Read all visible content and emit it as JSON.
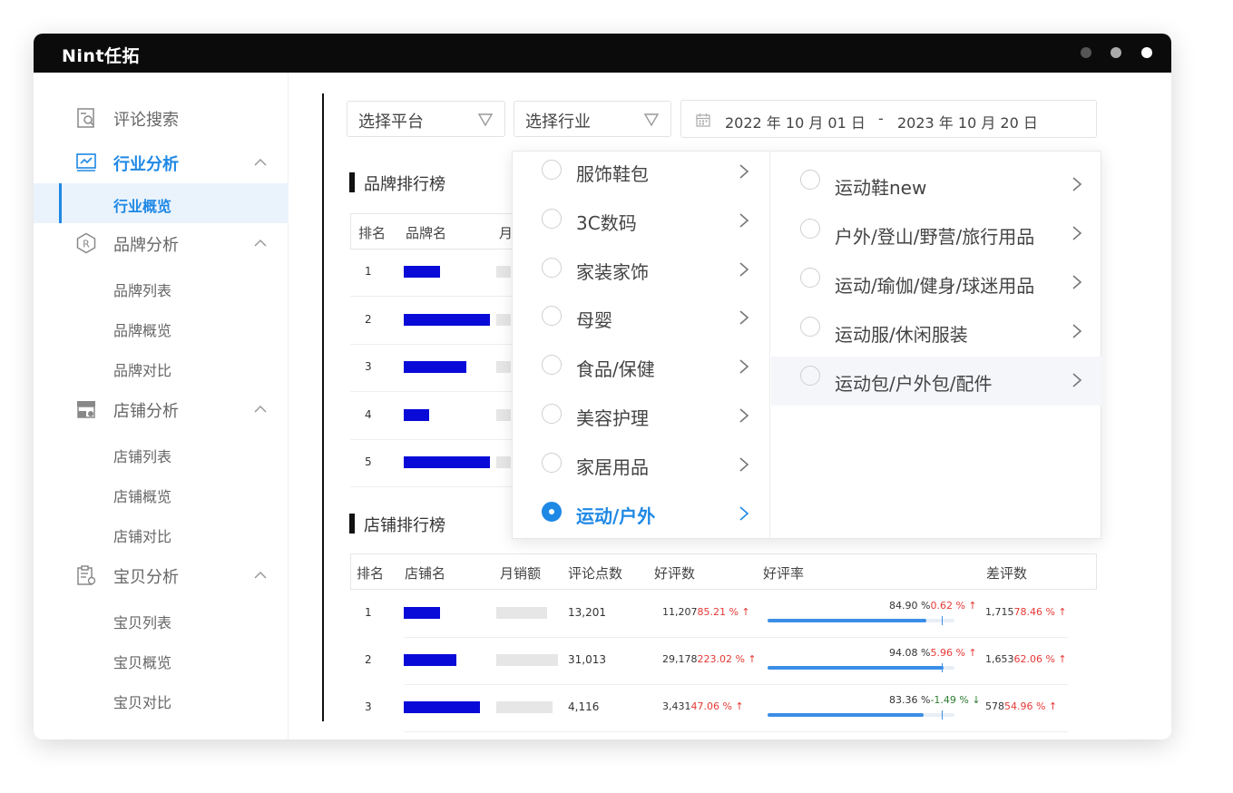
{
  "app": {
    "logo": "Nint任拓"
  },
  "window_dots": [
    "#555555",
    "#aaaaaa",
    "#ffffff"
  ],
  "accent_color": "#1e88e5",
  "sidebar": {
    "groups": [
      {
        "label": "评论搜索",
        "icon": "search-doc-icon",
        "active": false,
        "has_chevron": false,
        "items": []
      },
      {
        "label": "行业分析",
        "icon": "trend-chart-icon",
        "active": true,
        "has_chevron": true,
        "items": [
          {
            "label": "行业概览",
            "active": true
          }
        ]
      },
      {
        "label": "品牌分析",
        "icon": "brand-badge-icon",
        "active": false,
        "has_chevron": true,
        "items": [
          {
            "label": "品牌列表"
          },
          {
            "label": "品牌概览"
          },
          {
            "label": "品牌对比"
          }
        ]
      },
      {
        "label": "店铺分析",
        "icon": "store-icon",
        "active": false,
        "has_chevron": true,
        "items": [
          {
            "label": "店铺列表"
          },
          {
            "label": "店铺概览"
          },
          {
            "label": "店铺对比"
          }
        ]
      },
      {
        "label": "宝贝分析",
        "icon": "clipboard-icon",
        "active": false,
        "has_chevron": true,
        "items": [
          {
            "label": "宝贝列表"
          },
          {
            "label": "宝贝概览"
          },
          {
            "label": "宝贝对比"
          }
        ]
      }
    ]
  },
  "filters": {
    "platform": "选择平台",
    "industry": "选择行业",
    "date_start": "2022 年 10 月 01 日",
    "date_sep": "-",
    "date_end": "2023 年 10 月 20 日"
  },
  "brand_ranking": {
    "title": "品牌排行榜",
    "headers": [
      "排名",
      "品牌名",
      "月"
    ],
    "rows": [
      {
        "rank": "1",
        "name_fill": 0.36
      },
      {
        "rank": "2",
        "name_fill": 0.86
      },
      {
        "rank": "3",
        "name_fill": 0.63
      },
      {
        "rank": "4",
        "name_fill": 0.25
      },
      {
        "rank": "5",
        "name_fill": 0.86
      }
    ]
  },
  "store_ranking": {
    "title": "店铺排行榜",
    "headers": [
      "排名",
      "店铺名",
      "月销额",
      "评论点数",
      "好评数",
      "好评率",
      "差评数"
    ],
    "rows": [
      {
        "rank": "1",
        "name_fill": 0.36,
        "sales_fill": 0.82,
        "comments": "13,201",
        "good": "11,207",
        "good_change": "85.21 % ↑",
        "good_dir": "up",
        "rate": "84.90 %",
        "rate_change": "0.62 % ↑",
        "rate_dir": "up",
        "rate_fill": 0.849,
        "rate_mark": 0.93,
        "bad": "1,715",
        "bad_change": "78.46 % ↑",
        "bad_dir": "up"
      },
      {
        "rank": "2",
        "name_fill": 0.53,
        "sales_fill": 1.0,
        "comments": "31,013",
        "good": "29,178",
        "good_change": "223.02 % ↑",
        "good_dir": "up",
        "rate": "94.08 %",
        "rate_change": "5.96 % ↑",
        "rate_dir": "up",
        "rate_fill": 0.9408,
        "rate_mark": 0.93,
        "bad": "1,653",
        "bad_change": "62.06 % ↑",
        "bad_dir": "up"
      },
      {
        "rank": "3",
        "name_fill": 0.76,
        "sales_fill": 0.91,
        "comments": "4,116",
        "good": "3,431",
        "good_change": "47.06 % ↑",
        "good_dir": "up",
        "rate": "83.36 %",
        "rate_change": "-1.49 % ↓",
        "rate_dir": "down",
        "rate_fill": 0.8336,
        "rate_mark": 0.93,
        "bad": "578",
        "bad_change": "54.96 % ↑",
        "bad_dir": "up"
      }
    ]
  },
  "industry_dropdown": {
    "categories": [
      {
        "label": "服饰鞋包",
        "selected": false
      },
      {
        "label": "3C数码",
        "selected": false
      },
      {
        "label": "家装家饰",
        "selected": false
      },
      {
        "label": "母婴",
        "selected": false
      },
      {
        "label": "食品/保健",
        "selected": false
      },
      {
        "label": "美容护理",
        "selected": false
      },
      {
        "label": "家居用品",
        "selected": false
      },
      {
        "label": "运动/户外",
        "selected": true
      }
    ],
    "subcategories": [
      {
        "label": "运动鞋new",
        "hover": false
      },
      {
        "label": "户外/登山/野营/旅行用品",
        "hover": false
      },
      {
        "label": "运动/瑜伽/健身/球迷用品",
        "hover": false
      },
      {
        "label": "运动服/休闲服装",
        "hover": false
      },
      {
        "label": "运动包/户外包/配件",
        "hover": true
      }
    ]
  }
}
